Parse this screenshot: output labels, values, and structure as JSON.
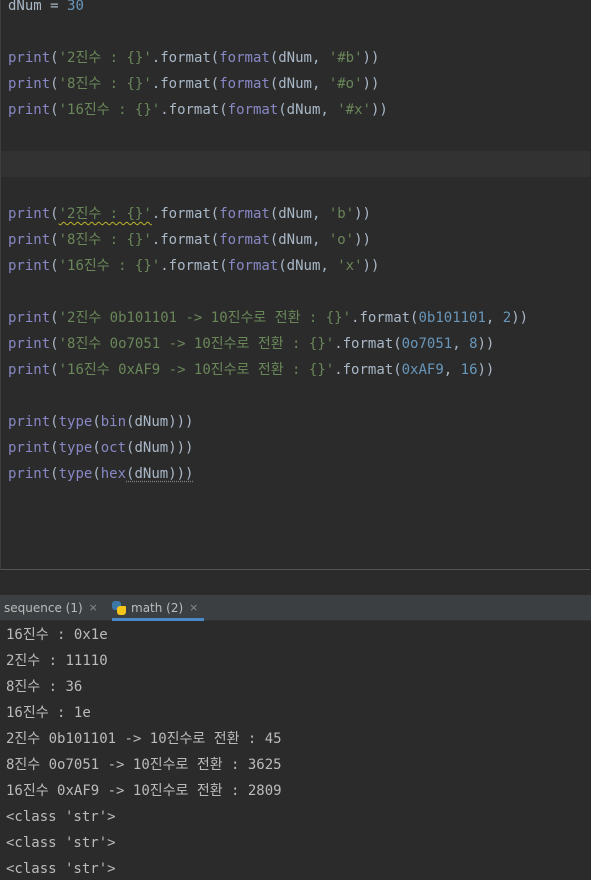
{
  "editor": {
    "lines": [
      {
        "tokens": [
          {
            "t": "dNum = ",
            "c": "var"
          },
          {
            "t": "30",
            "c": "num"
          }
        ]
      },
      {
        "tokens": [
          {
            "t": "print",
            "c": "kw"
          },
          {
            "t": "(",
            "c": "var"
          },
          {
            "t": "'2진수 : {}'",
            "c": "str"
          },
          {
            "t": ".format(",
            "c": "var"
          },
          {
            "t": "format",
            "c": "kw"
          },
          {
            "t": "(dNum, ",
            "c": "var"
          },
          {
            "t": "'#b'",
            "c": "str"
          },
          {
            "t": "))",
            "c": "var"
          }
        ]
      },
      {
        "tokens": [
          {
            "t": "print",
            "c": "kw"
          },
          {
            "t": "(",
            "c": "var"
          },
          {
            "t": "'8진수 : {}'",
            "c": "str"
          },
          {
            "t": ".format(",
            "c": "var"
          },
          {
            "t": "format",
            "c": "kw"
          },
          {
            "t": "(dNum, ",
            "c": "var"
          },
          {
            "t": "'#o'",
            "c": "str"
          },
          {
            "t": "))",
            "c": "var"
          }
        ]
      },
      {
        "tokens": [
          {
            "t": "print",
            "c": "kw"
          },
          {
            "t": "(",
            "c": "var"
          },
          {
            "t": "'16진수 : {}'",
            "c": "str"
          },
          {
            "t": ".format(",
            "c": "var"
          },
          {
            "t": "format",
            "c": "kw"
          },
          {
            "t": "(dNum, ",
            "c": "var"
          },
          {
            "t": "'#x'",
            "c": "str"
          },
          {
            "t": "))",
            "c": "var"
          }
        ]
      },
      {
        "tokens": [
          {
            "t": "print",
            "c": "kw"
          },
          {
            "t": "(",
            "c": "var"
          },
          {
            "t": "'2진수 : {}'",
            "c": "str"
          },
          {
            "t": ".format(",
            "c": "var"
          },
          {
            "t": "format",
            "c": "kw"
          },
          {
            "t": "(dNum, ",
            "c": "var"
          },
          {
            "t": "'b'",
            "c": "str"
          },
          {
            "t": "))",
            "c": "var"
          }
        ],
        "squiggle": true
      },
      {
        "tokens": [
          {
            "t": "print",
            "c": "kw"
          },
          {
            "t": "(",
            "c": "var"
          },
          {
            "t": "'8진수 : {}'",
            "c": "str"
          },
          {
            "t": ".format(",
            "c": "var"
          },
          {
            "t": "format",
            "c": "kw"
          },
          {
            "t": "(dNum, ",
            "c": "var"
          },
          {
            "t": "'o'",
            "c": "str"
          },
          {
            "t": "))",
            "c": "var"
          }
        ]
      },
      {
        "tokens": [
          {
            "t": "print",
            "c": "kw"
          },
          {
            "t": "(",
            "c": "var"
          },
          {
            "t": "'16진수 : {}'",
            "c": "str"
          },
          {
            "t": ".format(",
            "c": "var"
          },
          {
            "t": "format",
            "c": "kw"
          },
          {
            "t": "(dNum, ",
            "c": "var"
          },
          {
            "t": "'x'",
            "c": "str"
          },
          {
            "t": "))",
            "c": "var"
          }
        ]
      },
      {
        "tokens": [
          {
            "t": "print",
            "c": "kw"
          },
          {
            "t": "(",
            "c": "var"
          },
          {
            "t": "'2진수 0b101101 -> 10진수로 전환 : {}'",
            "c": "str"
          },
          {
            "t": ".format(",
            "c": "var"
          },
          {
            "t": "0b101101",
            "c": "num"
          },
          {
            "t": ", ",
            "c": "var"
          },
          {
            "t": "2",
            "c": "num"
          },
          {
            "t": "))",
            "c": "var"
          }
        ]
      },
      {
        "tokens": [
          {
            "t": "print",
            "c": "kw"
          },
          {
            "t": "(",
            "c": "var"
          },
          {
            "t": "'8진수 0o7051 -> 10진수로 전환 : {}'",
            "c": "str"
          },
          {
            "t": ".format(",
            "c": "var"
          },
          {
            "t": "0o7051",
            "c": "num"
          },
          {
            "t": ", ",
            "c": "var"
          },
          {
            "t": "8",
            "c": "num"
          },
          {
            "t": "))",
            "c": "var"
          }
        ]
      },
      {
        "tokens": [
          {
            "t": "print",
            "c": "kw"
          },
          {
            "t": "(",
            "c": "var"
          },
          {
            "t": "'16진수 0xAF9 -> 10진수로 전환 : {}'",
            "c": "str"
          },
          {
            "t": ".format(",
            "c": "var"
          },
          {
            "t": "0xAF9",
            "c": "num"
          },
          {
            "t": ", ",
            "c": "var"
          },
          {
            "t": "16",
            "c": "num"
          },
          {
            "t": "))",
            "c": "var"
          }
        ]
      },
      {
        "tokens": [
          {
            "t": "print",
            "c": "kw"
          },
          {
            "t": "(",
            "c": "var"
          },
          {
            "t": "type",
            "c": "kw"
          },
          {
            "t": "(",
            "c": "var"
          },
          {
            "t": "bin",
            "c": "kw"
          },
          {
            "t": "(dNum)))",
            "c": "var"
          }
        ]
      },
      {
        "tokens": [
          {
            "t": "print",
            "c": "kw"
          },
          {
            "t": "(",
            "c": "var"
          },
          {
            "t": "type",
            "c": "kw"
          },
          {
            "t": "(",
            "c": "var"
          },
          {
            "t": "oct",
            "c": "kw"
          },
          {
            "t": "(dNum)))",
            "c": "var"
          }
        ]
      },
      {
        "tokens": [
          {
            "t": "print",
            "c": "kw"
          },
          {
            "t": "(",
            "c": "var"
          },
          {
            "t": "type",
            "c": "kw"
          },
          {
            "t": "(",
            "c": "var"
          },
          {
            "t": "hex",
            "c": "kw"
          },
          {
            "t": "(dNum)))",
            "c": "var"
          }
        ]
      }
    ]
  },
  "run_tabs": [
    {
      "label": "sequence (1)",
      "close": "×",
      "icon": "none"
    },
    {
      "label": "math (2)",
      "close": "×",
      "icon": "python-icon",
      "active": true
    }
  ],
  "console": {
    "lines": [
      "16진수 : 0x1e",
      "2진수 : 11110",
      "8진수 : 36",
      "16진수 : 1e",
      "2진수 0b101101 -> 10진수로 전환 : 45",
      "8진수 0o7051 -> 10진수로 전환 : 3625",
      "16진수 0xAF9 -> 10진수로 전환 : 2809",
      "<class 'str'>",
      "<class 'str'>",
      "<class 'str'>"
    ]
  },
  "colors": {
    "keyword": "#8888c6",
    "string": "#6a8759",
    "number": "#6897bb",
    "text": "#a9b7c6",
    "background": "#2b2b2b",
    "tab_underline": "#4a88c7"
  }
}
